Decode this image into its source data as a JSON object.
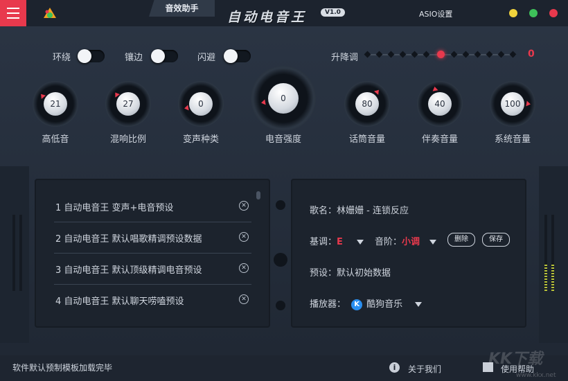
{
  "colors": {
    "accent": "#e8394d",
    "background": "#222b38",
    "panel": "#1c232d",
    "win_yellow": "#f1d33c",
    "win_green": "#3ec15a",
    "win_red": "#e8394d"
  },
  "titlebar": {
    "menu_icon": "hamburger-icon",
    "logo_icon": "app-logo-icon",
    "tab_label": "音效助手",
    "app_title": "自动电音王",
    "version": "V1.0",
    "asio_label": "ASIO设置"
  },
  "toggles": [
    {
      "label": "环绕",
      "on": false
    },
    {
      "label": "镶边",
      "on": false
    },
    {
      "label": "闪避",
      "on": false
    }
  ],
  "pitch": {
    "label": "升降调",
    "value": "0",
    "level": 0.5
  },
  "knobs": [
    {
      "label": "高低音",
      "value": "21"
    },
    {
      "label": "混响比例",
      "value": "27"
    },
    {
      "label": "变声种类",
      "value": "0"
    },
    {
      "label": "电音强度",
      "value": "0"
    },
    {
      "label": "话筒音量",
      "value": "80"
    },
    {
      "label": "伴奏音量",
      "value": "40"
    },
    {
      "label": "系统音量",
      "value": "100"
    }
  ],
  "presets": [
    "1 自动电音王 变声+电音预设",
    "2 自动电音王 默认唱歌精调预设数据",
    "3 自动电音王 默认顶级精调电音预设",
    "4 自动电音王 默认聊天唠嗑预设"
  ],
  "info": {
    "song_label": "歌名：",
    "song_value": "林姗姗 - 连锁反应",
    "key_label": "基调：",
    "key_value": "E",
    "scale_label": "音阶：",
    "scale_value": "小调",
    "delete_label": "删除",
    "save_label": "保存",
    "preset_label": "预设：",
    "preset_value": "默认初始数据",
    "player_label": "播放器：",
    "player_icon_letter": "K",
    "player_value": "酷狗音乐"
  },
  "status": {
    "message": "软件默认预制模板加载完毕",
    "about_icon": "info-icon",
    "about_label": "关于我们",
    "help_icon": "clapperboard-icon",
    "help_label": "使用帮助"
  },
  "watermark": {
    "text": "KK下载",
    "url": "www.kkx.net"
  }
}
